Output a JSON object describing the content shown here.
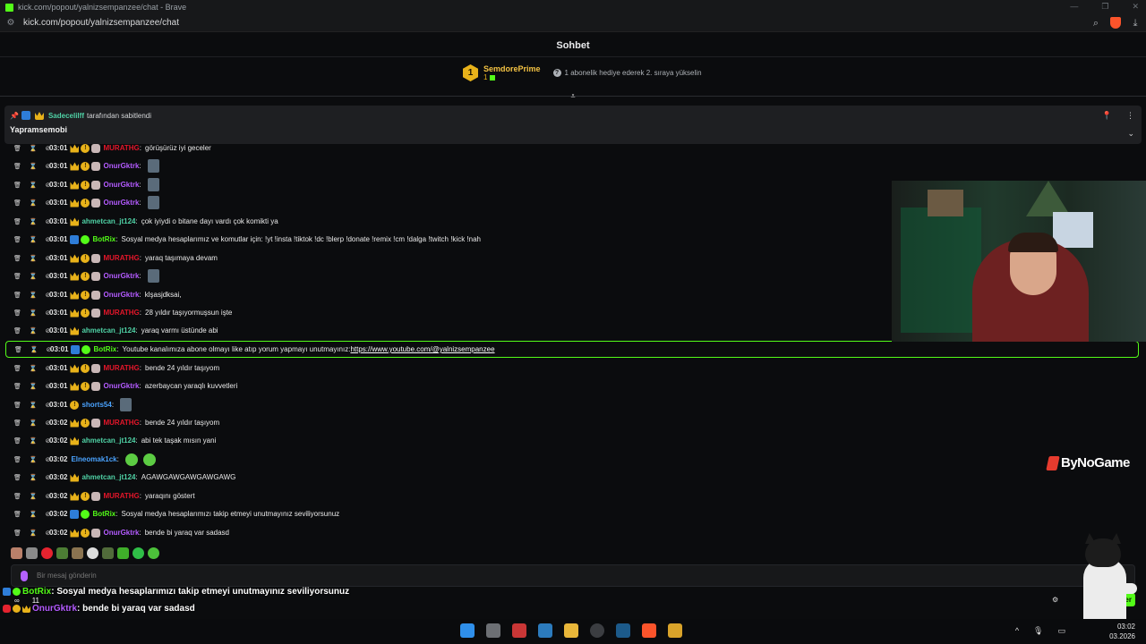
{
  "browser": {
    "window_title": "kick.com/popout/yalnizsempanzee/chat - Brave",
    "url": "kick.com/popout/yalnizsempanzee/chat"
  },
  "chat": {
    "title": "Sohbet",
    "leaderboard": {
      "rank": "1",
      "user": "SemdorePrime",
      "count": "1",
      "hint": "1 abonelik hediye ederek 2. sıraya yükselin"
    },
    "pinned": {
      "pinned_by": "Sadecelilff",
      "pinned_suffix": "tarafından sabitlendi",
      "message": "Yapramsemobi"
    },
    "input_placeholder": "Bir mesaj gönderin",
    "messages": [
      {
        "time": "03:01",
        "user": "MURATHG",
        "color": "#e4162a",
        "badges": [
          "crown",
          "sub",
          "avatar"
        ],
        "text": "görüşürüz iyi geceler",
        "emotes": 0
      },
      {
        "time": "03:01",
        "user": "OnurGktrk",
        "color": "#b45bff",
        "badges": [
          "crown",
          "sub",
          "avatar"
        ],
        "text": "",
        "emotes": 1
      },
      {
        "time": "03:01",
        "user": "OnurGktrk",
        "color": "#b45bff",
        "badges": [
          "crown",
          "sub",
          "avatar"
        ],
        "text": "",
        "emotes": 1
      },
      {
        "time": "03:01",
        "user": "OnurGktrk",
        "color": "#b45bff",
        "badges": [
          "crown",
          "sub",
          "avatar"
        ],
        "text": "",
        "emotes": 1
      },
      {
        "time": "03:01",
        "user": "ahmetcan_jt124",
        "color": "#4fd1a5",
        "badges": [
          "crown"
        ],
        "text": "çok iyiydi o bitane dayı vardı çok komikti ya",
        "emotes": 0
      },
      {
        "time": "03:01",
        "user": "BotRix",
        "color": "#53fc18",
        "badges": [
          "mod",
          "ver"
        ],
        "text": "Sosyal medya hesaplarımız ve komutlar için: !yt !insta !tiktok !dc !blerp !donate !remix !cm !dalga !twitch !kick !nah",
        "emotes": 0
      },
      {
        "time": "03:01",
        "user": "MURATHG",
        "color": "#e4162a",
        "badges": [
          "crown",
          "sub",
          "avatar"
        ],
        "text": "yaraq taşımaya devam",
        "emotes": 0
      },
      {
        "time": "03:01",
        "user": "OnurGktrk",
        "color": "#b45bff",
        "badges": [
          "crown",
          "sub",
          "avatar"
        ],
        "text": "",
        "emotes": 1
      },
      {
        "time": "03:01",
        "user": "OnurGktrk",
        "color": "#b45bff",
        "badges": [
          "crown",
          "sub",
          "avatar"
        ],
        "text": "klşasjdksai,",
        "emotes": 0
      },
      {
        "time": "03:01",
        "user": "MURATHG",
        "color": "#e4162a",
        "badges": [
          "crown",
          "sub",
          "avatar"
        ],
        "text": "28 yıldır taşıyormuşsun işte",
        "emotes": 0
      },
      {
        "time": "03:01",
        "user": "ahmetcan_jt124",
        "color": "#4fd1a5",
        "badges": [
          "crown"
        ],
        "text": "yaraq varmı üstünde abi",
        "emotes": 0
      },
      {
        "time": "03:01",
        "user": "BotRix",
        "color": "#53fc18",
        "badges": [
          "mod",
          "ver"
        ],
        "text": "Youtube kanalımıza abone olmayı like atıp yorum yapmayı unutmayınız: ",
        "link": "https://www.youtube.com/@yalnizsempanzee",
        "highlight": true,
        "emotes": 0
      },
      {
        "time": "03:01",
        "user": "MURATHG",
        "color": "#e4162a",
        "badges": [
          "crown",
          "sub",
          "avatar"
        ],
        "text": "bende 24 yıldır taşıyom",
        "emotes": 0
      },
      {
        "time": "03:01",
        "user": "OnurGktrk",
        "color": "#b45bff",
        "badges": [
          "crown",
          "sub",
          "avatar"
        ],
        "text": "azerbaycan yaraqlı kuvvetleri",
        "emotes": 0
      },
      {
        "time": "03:01",
        "user": "shorts54",
        "color": "#4aa3ff",
        "badges": [
          "sub"
        ],
        "text": "",
        "emotes": 1
      },
      {
        "time": "03:02",
        "user": "MURATHG",
        "color": "#e4162a",
        "badges": [
          "crown",
          "sub",
          "avatar"
        ],
        "text": "bende 24 yıldır taşıyom",
        "emotes": 0
      },
      {
        "time": "03:02",
        "user": "ahmetcan_jt124",
        "color": "#4fd1a5",
        "badges": [
          "crown"
        ],
        "text": "abi tek taşak mısın yani",
        "emotes": 0
      },
      {
        "time": "03:02",
        "user": "Elneomak1ck",
        "color": "#4aa3ff",
        "badges": [],
        "text": "",
        "emotes": 2,
        "green": true
      },
      {
        "time": "03:02",
        "user": "ahmetcan_jt124",
        "color": "#4fd1a5",
        "badges": [
          "crown"
        ],
        "text": "AGAWGAWGAWGAWGAWG",
        "emotes": 0
      },
      {
        "time": "03:02",
        "user": "MURATHG",
        "color": "#e4162a",
        "badges": [
          "crown",
          "sub",
          "avatar"
        ],
        "text": "yaraqını göstert",
        "emotes": 0
      },
      {
        "time": "03:02",
        "user": "BotRix",
        "color": "#53fc18",
        "badges": [
          "mod",
          "ver"
        ],
        "text": "Sosyal medya hesaplarımızı takip etmeyi unutmayınız seviliyorsunuz",
        "emotes": 0
      },
      {
        "time": "03:02",
        "user": "OnurGktrk",
        "color": "#b45bff",
        "badges": [
          "crown",
          "sub",
          "avatar"
        ],
        "text": "bende bi yaraq var sadasd",
        "emotes": 0
      }
    ]
  },
  "overlay": {
    "watermark": "ByNoGame",
    "line1_user": "BotRix",
    "line1_text": ": Sosyal medya hesaplarımızı takip etmeyi unutmayınız seviliyorsunuz",
    "line2_user": "OnurGktrk",
    "line2_text": ": bende bi yaraq var sadasd",
    "stat_a": "∞",
    "stat_b": "11",
    "send_label": "der"
  },
  "taskbar": {
    "time": "03:02",
    "date": "03.2026"
  }
}
